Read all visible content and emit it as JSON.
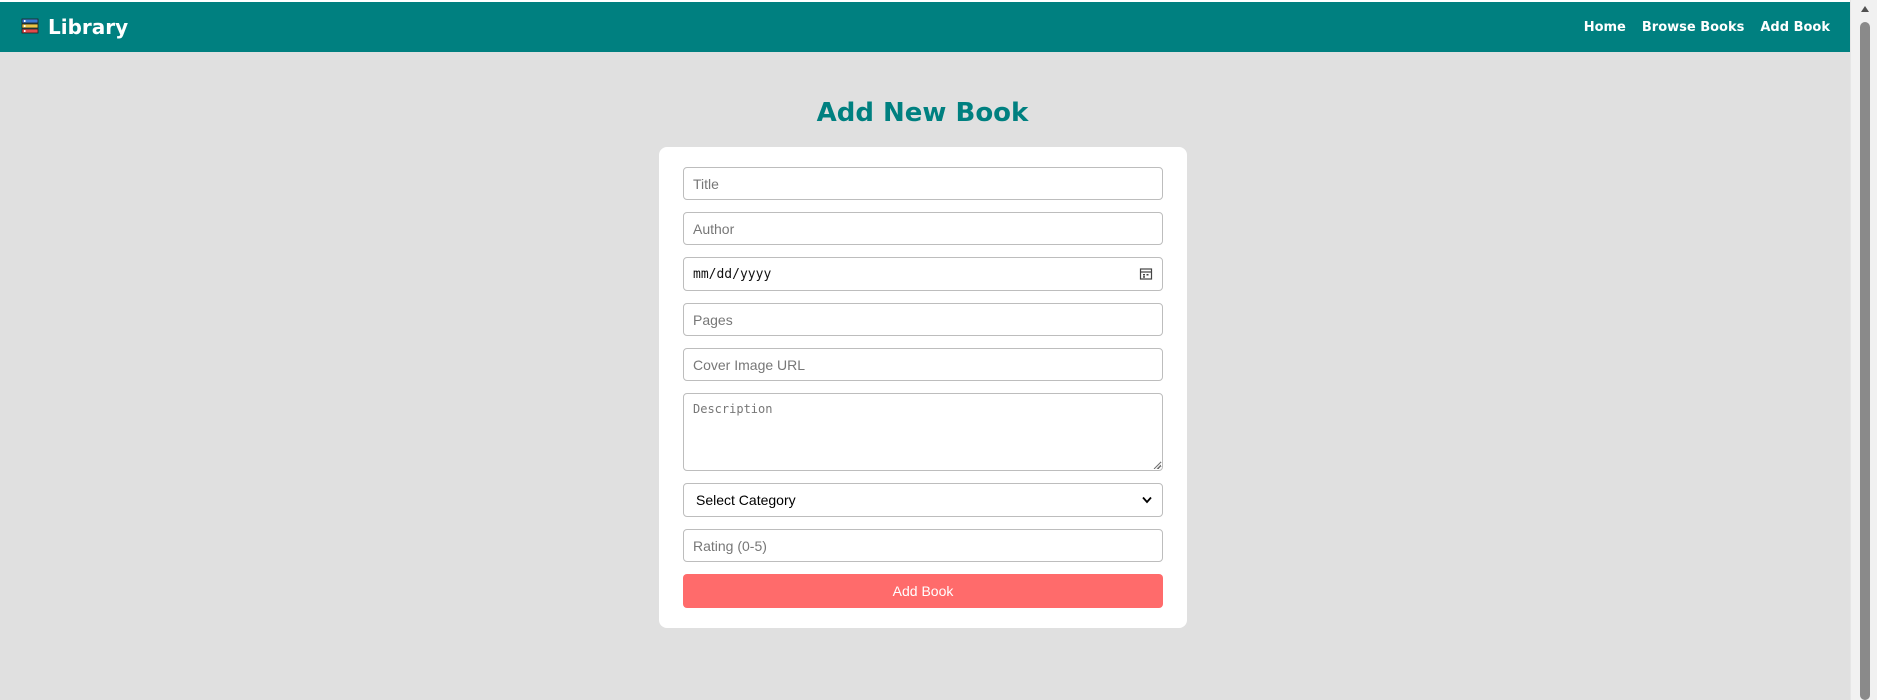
{
  "app": {
    "brand": "Library",
    "brand_icon": "books-icon"
  },
  "nav": {
    "items": [
      {
        "label": "Home"
      },
      {
        "label": "Browse Books"
      },
      {
        "label": "Add Book"
      }
    ]
  },
  "page": {
    "title": "Add New Book"
  },
  "form": {
    "title": {
      "placeholder": "Title",
      "value": ""
    },
    "author": {
      "placeholder": "Author",
      "value": ""
    },
    "date": {
      "display": "mm/dd/yyyy",
      "icon": "calendar-icon"
    },
    "pages": {
      "placeholder": "Pages",
      "value": ""
    },
    "cover": {
      "placeholder": "Cover Image URL",
      "value": ""
    },
    "description": {
      "placeholder": "Description",
      "value": ""
    },
    "category": {
      "selected": "Select Category",
      "icon": "chevron-down-icon"
    },
    "rating": {
      "placeholder": "Rating (0-5)",
      "value": ""
    },
    "submit_label": "Add Book"
  },
  "colors": {
    "navbar": "#008080",
    "title": "#008080",
    "background": "#e0e0e0",
    "button": "#ff6b6b"
  }
}
